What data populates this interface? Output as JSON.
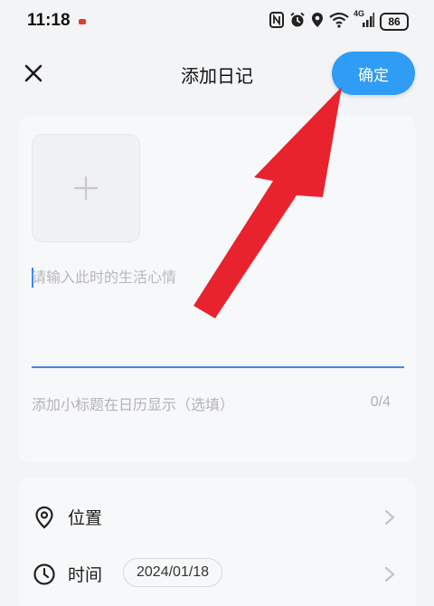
{
  "status_bar": {
    "time": "11:18",
    "network_label": "4G",
    "battery": "86"
  },
  "header": {
    "title": "添加日记",
    "confirm_label": "确定"
  },
  "editor": {
    "mood_placeholder": "请输入此时的生活心情",
    "subtitle_placeholder": "添加小标题在日历显示（选填）",
    "subtitle_counter": "0/4"
  },
  "meta": {
    "location_label": "位置",
    "time_label": "时间",
    "date_value": "2024/01/18"
  },
  "colors": {
    "accent": "#2f9cf5",
    "annotation_arrow": "#e8232d",
    "underline": "#3f8ae6"
  },
  "icons": {
    "close": "close-icon",
    "add_photo": "plus-icon",
    "location": "location-pin-icon",
    "time": "clock-icon",
    "chevron": "chevron-right-icon"
  }
}
